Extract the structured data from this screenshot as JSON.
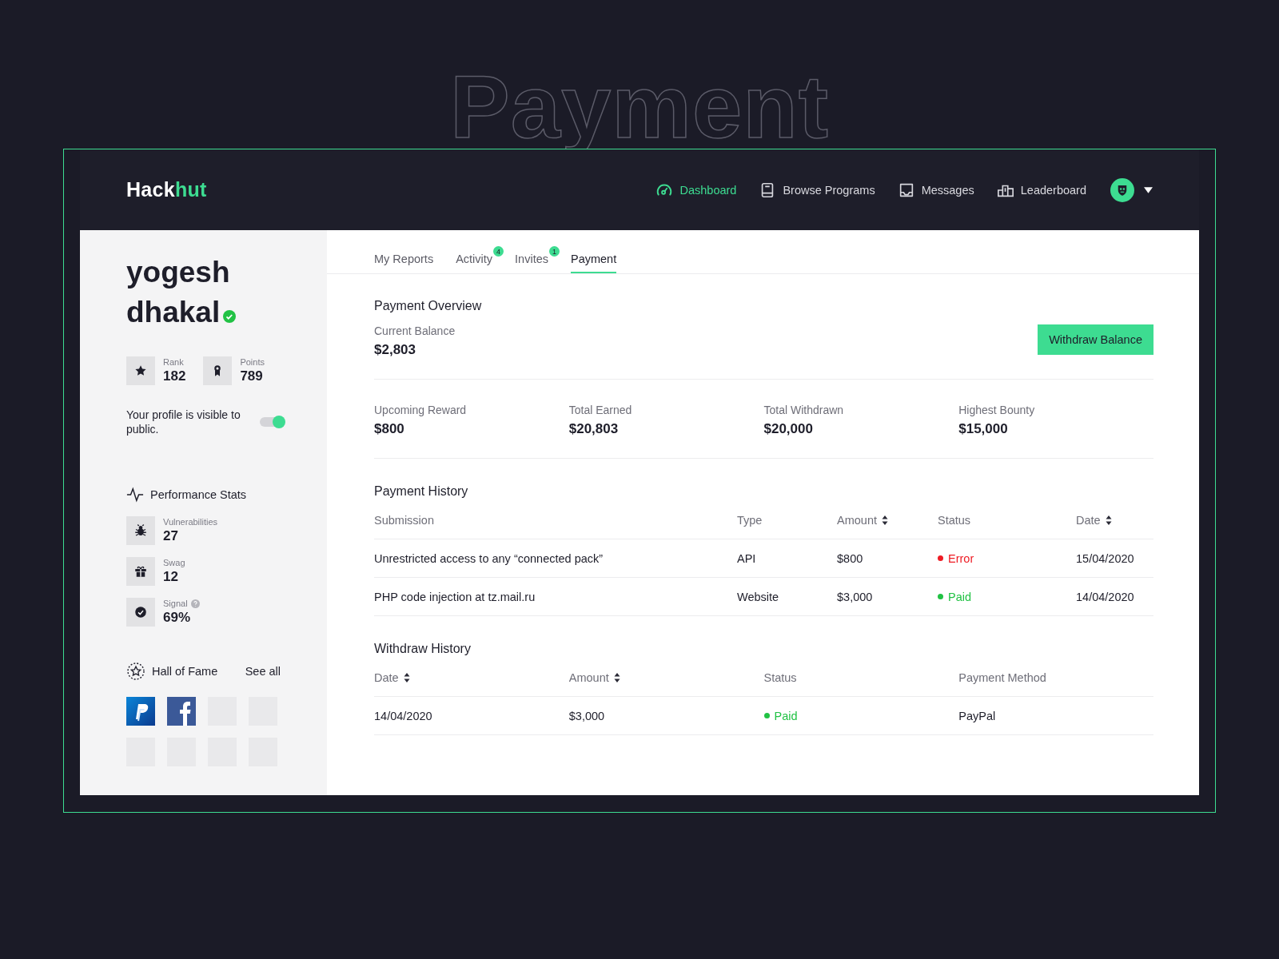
{
  "backdrop_title": "Payment",
  "brand": {
    "name": "Hack",
    "accent": "hut"
  },
  "nav": [
    {
      "label": "Dashboard",
      "selected": true
    },
    {
      "label": "Browse Programs",
      "selected": false
    },
    {
      "label": "Messages",
      "selected": false
    },
    {
      "label": "Leaderboard",
      "selected": false
    }
  ],
  "profile": {
    "name": "yogesh dhakal",
    "verified": true,
    "stats": [
      {
        "label": "Rank",
        "value": "182"
      },
      {
        "label": "Points",
        "value": "789"
      }
    ],
    "visibility_text": "Your profile is visible to public.",
    "public": true
  },
  "performance": {
    "title": "Performance Stats",
    "items": [
      {
        "label": "Vulnerabilities",
        "value": "27",
        "help": false
      },
      {
        "label": "Swag",
        "value": "12",
        "help": false
      },
      {
        "label": "Signal",
        "value": "69%",
        "help": true
      }
    ]
  },
  "hall_of_fame": {
    "title": "Hall of Fame",
    "link": "See all",
    "logos": [
      {
        "kind": "paypal"
      },
      {
        "kind": "facebook"
      },
      {
        "kind": "empty"
      },
      {
        "kind": "empty"
      },
      {
        "kind": "empty"
      },
      {
        "kind": "empty"
      },
      {
        "kind": "empty"
      },
      {
        "kind": "empty"
      }
    ]
  },
  "tabs": [
    {
      "label": "My Reports",
      "selected": false
    },
    {
      "label": "Activity",
      "badge": "4",
      "selected": false
    },
    {
      "label": "Invites",
      "badge": "1",
      "selected": false
    },
    {
      "label": "Payment",
      "selected": true
    }
  ],
  "overview": {
    "title": "Payment Overview",
    "balance_label": "Current Balance",
    "balance": "$2,803",
    "button": "Withdraw Balance",
    "metrics": [
      {
        "label": "Upcoming Reward",
        "value": "$800"
      },
      {
        "label": "Total Earned",
        "value": "$20,803"
      },
      {
        "label": "Total Withdrawn",
        "value": "$20,000"
      },
      {
        "label": "Highest Bounty",
        "value": "$15,000"
      }
    ]
  },
  "payment_history": {
    "title": "Payment History",
    "columns": [
      {
        "label": "Submission",
        "sortable": false
      },
      {
        "label": "Type",
        "sortable": false
      },
      {
        "label": "Amount",
        "sortable": true
      },
      {
        "label": "Status",
        "sortable": false
      },
      {
        "label": "Date",
        "sortable": true
      }
    ],
    "rows": [
      {
        "submission": "Unrestricted access to any “connected pack”",
        "type": "API",
        "amount": "$800",
        "status": "Error",
        "color": "#ee1c24",
        "date": "15/04/2020"
      },
      {
        "submission": "PHP code injection at tz.mail.ru",
        "type": "Website",
        "amount": "$3,000",
        "status": "Paid",
        "color": "#21c244",
        "date": "14/04/2020"
      }
    ]
  },
  "withdraw_history": {
    "title": "Withdraw History",
    "columns": [
      {
        "label": "Date",
        "sortable": true
      },
      {
        "label": "Amount",
        "sortable": true
      },
      {
        "label": "Status",
        "sortable": false
      },
      {
        "label": "Payment Method",
        "sortable": false
      }
    ],
    "rows": [
      {
        "date": "14/04/2020",
        "amount": "$3,000",
        "status": "Paid",
        "color": "#21c244",
        "method": "PayPal"
      }
    ]
  }
}
